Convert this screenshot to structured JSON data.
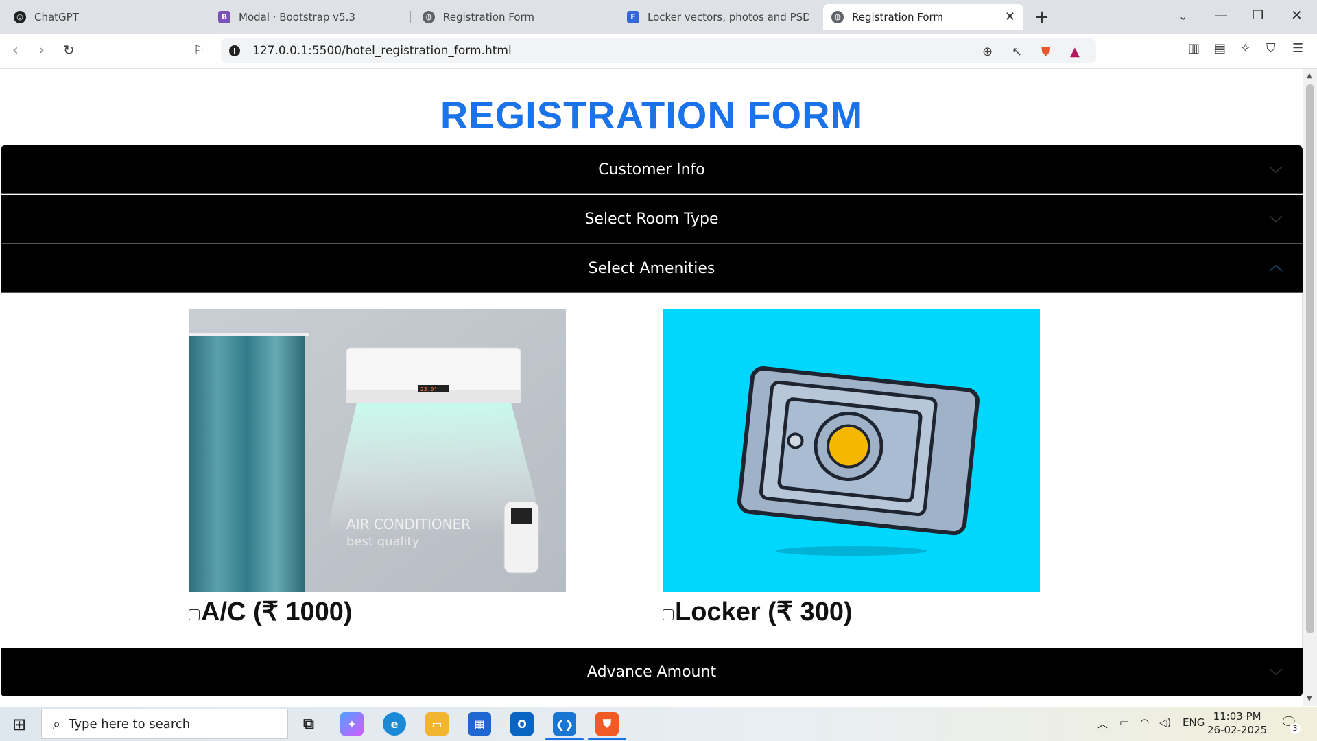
{
  "browser": {
    "tabs": [
      {
        "title": "ChatGPT",
        "favicon_color": "#202123",
        "favicon_glyph": "◎"
      },
      {
        "title": "Modal · Bootstrap v5.3",
        "favicon_color": "#7952b3",
        "favicon_glyph": "B"
      },
      {
        "title": "Registration Form",
        "favicon_color": "#5f6368",
        "favicon_glyph": "◍"
      },
      {
        "title": "Locker vectors, photos and PSD files",
        "favicon_color": "#3566d6",
        "favicon_glyph": "F"
      },
      {
        "title": "Registration Form",
        "favicon_color": "#5f6368",
        "favicon_glyph": "◍"
      }
    ],
    "active_tab_index": 4,
    "url": "127.0.0.1:5500/hotel_registration_form.html"
  },
  "page": {
    "title": "REGISTRATION FORM",
    "sections": [
      {
        "label": "Customer Info",
        "expanded": false
      },
      {
        "label": "Select Room Type",
        "expanded": false
      },
      {
        "label": "Select Amenities",
        "expanded": true
      },
      {
        "label": "Advance Amount",
        "expanded": false
      }
    ],
    "amenities": [
      {
        "label": "A/C (₹ 1000)",
        "checked": false,
        "image_text_1": "AIR CONDITIONER",
        "image_text_2": "best quality",
        "ac_display": "23.0°"
      },
      {
        "label": "Locker (₹ 300)",
        "checked": false
      }
    ],
    "colors": {
      "title": "#1a73e8",
      "header_bg": "#000000",
      "locker_bg": "#00d7ff"
    }
  },
  "taskbar": {
    "search_placeholder": "Type here to search",
    "language": "ENG",
    "time": "11:03 PM",
    "date": "26-02-2025",
    "notification_count": "3"
  }
}
